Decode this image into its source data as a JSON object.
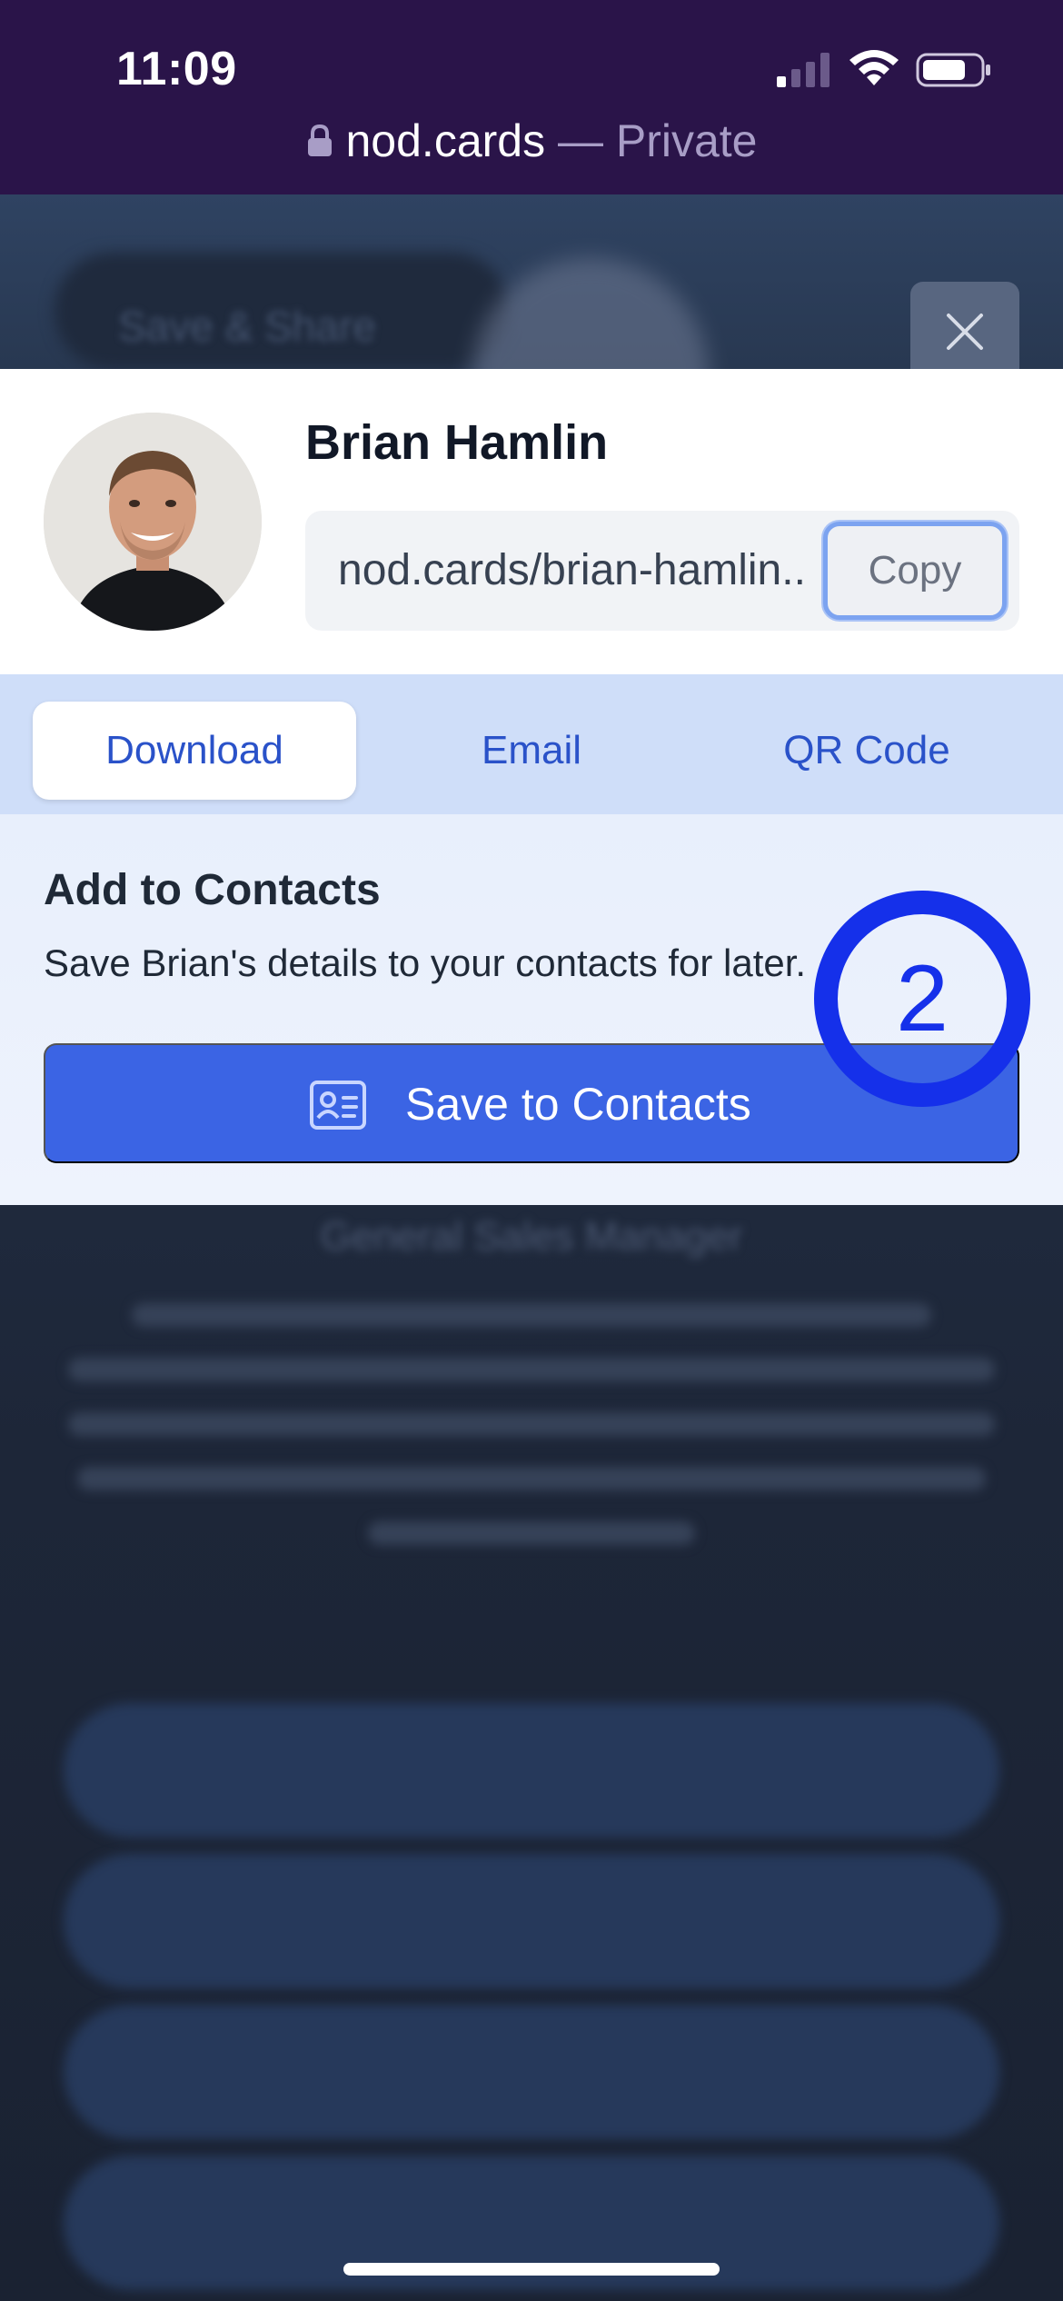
{
  "status_bar": {
    "time": "11:09",
    "url_domain": "nod.cards",
    "url_suffix": " — Private"
  },
  "background": {
    "save_share_label": "Save & Share",
    "subtitle": "General Sales Manager"
  },
  "sheet": {
    "name": "Brian Hamlin",
    "link": "nod.cards/brian-hamlin..",
    "copy_label": "Copy",
    "tabs": [
      {
        "label": "Download",
        "active": true
      },
      {
        "label": "Email",
        "active": false
      },
      {
        "label": "QR Code",
        "active": false
      }
    ],
    "panel": {
      "title": "Add to Contacts",
      "description": "Save Brian's details to your contacts for later.",
      "button_label": "Save to Contacts"
    }
  },
  "marker": {
    "number": "2",
    "color": "#1530ea"
  },
  "colors": {
    "status_bar_bg": "#2a1449",
    "primary": "#3b64e4",
    "tab_strip": "#cfdef9",
    "tab_text": "#2a52c9"
  },
  "icons": [
    "lock-icon",
    "signal-icon",
    "wifi-icon",
    "battery-icon",
    "close-icon",
    "contact-card-icon"
  ]
}
